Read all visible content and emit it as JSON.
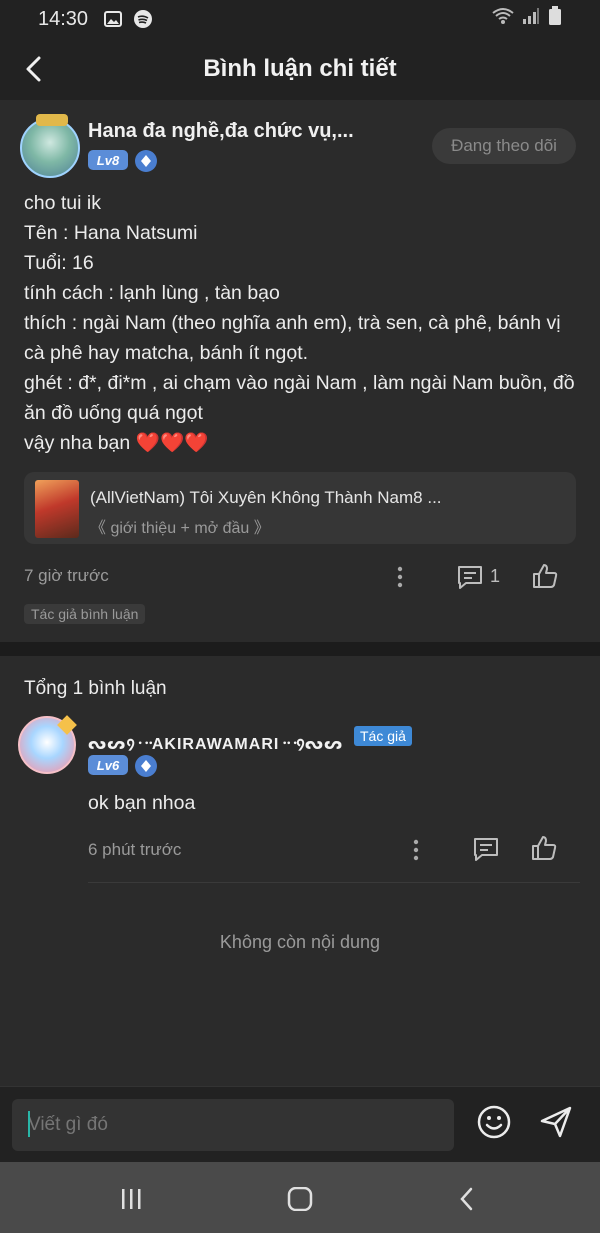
{
  "status_bar": {
    "time": "14:30",
    "icons": [
      "image-icon",
      "spotify-icon",
      "wifi-icon",
      "signal-icon",
      "battery-icon"
    ]
  },
  "header": {
    "title": "Bình luận chi tiết",
    "back_icon": "back-arrow-icon"
  },
  "post": {
    "author_name": "Hana đa nghề,đa chức vụ,...",
    "level": "Lv8",
    "follow_label": "Đang theo dõi",
    "lines": [
      "cho tui ik",
      "Tên : Hana Natsumi",
      "Tuổi: 16",
      "tính cách : lạnh lùng , tàn bạo",
      "thích : ngài Nam (theo nghĩa anh em), trà sen, cà phê, bánh vị cà phê hay matcha, bánh ít ngọt.",
      "ghét : đ*, đi*m , ai chạm vào ngài Nam , làm ngài Nam buồn, đồ ăn đồ uống quá ngọt",
      "vậy nha bạn ❤️❤️❤️"
    ],
    "story_card": {
      "title": "(AllVietNam) Tôi Xuyên Không Thành Nam8 ...",
      "subtitle": "《 giới thiệu + mở đầu 》"
    },
    "time": "7 giờ trước",
    "comment_count": "1",
    "author_tag": "Tác giả bình luận"
  },
  "comments": {
    "total_label": "Tổng 1 bình luận",
    "items": [
      {
        "name": "ᔓᔕ᠀᠂᠃AKIRAWAMARI᠃᠂᠀ᔓᔕ",
        "tag": "Tác giả",
        "level": "Lv6",
        "text": "ok bạn nhoa",
        "time": "6 phút trước"
      }
    ],
    "no_more": "Không còn nội dung"
  },
  "input": {
    "placeholder": "Viết gì đó"
  },
  "colors": {
    "background": "#2b2b2b",
    "header": "#222222",
    "accent_blue": "#3e89d6",
    "level_badge": "#5b8dd8",
    "heart": "#e53935"
  }
}
